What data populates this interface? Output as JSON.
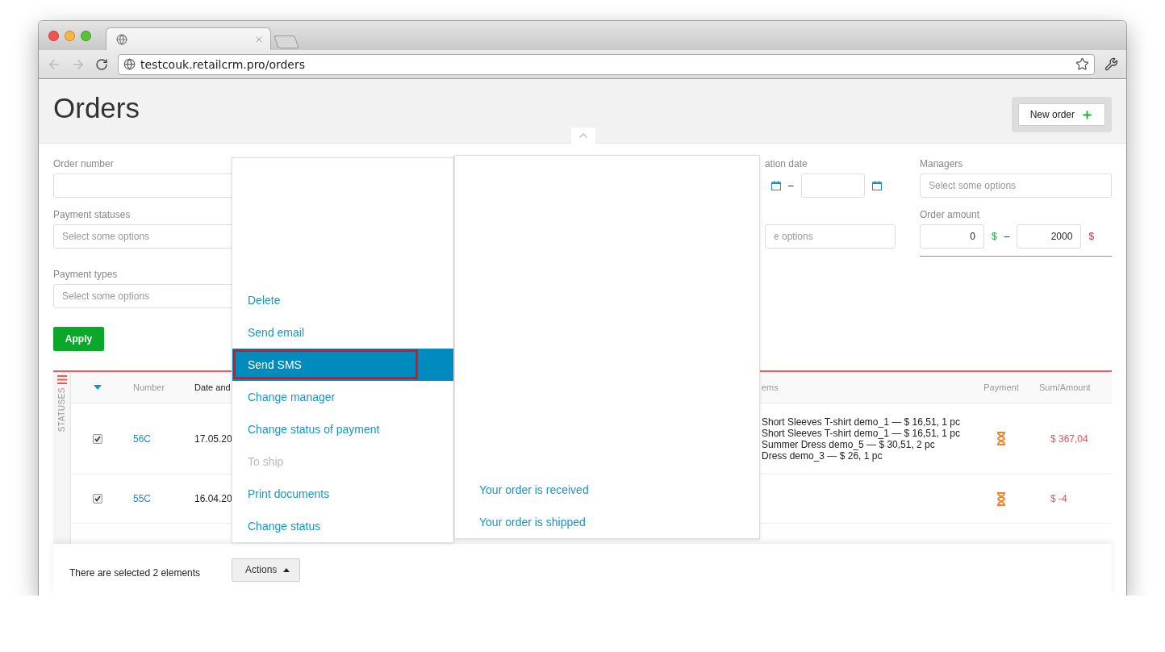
{
  "browser": {
    "url": "testcouk.retailcrm.pro/orders"
  },
  "page": {
    "title": "Orders",
    "new_order_button": "New order"
  },
  "filters": {
    "order_number": {
      "label": "Order number"
    },
    "payment_statuses": {
      "label": "Payment statuses",
      "placeholder": "Select some options"
    },
    "payment_types": {
      "label": "Payment types",
      "placeholder": "Select some options"
    },
    "date": {
      "label": "ation date",
      "separator": "–"
    },
    "column_3_field": {
      "placeholder": "e options"
    },
    "managers": {
      "label": "Managers",
      "placeholder": "Select some options"
    },
    "order_amount": {
      "label": "Order amount",
      "from": "0",
      "to": "2000",
      "currency": "$",
      "separator": "–"
    },
    "apply_button": "Apply"
  },
  "table": {
    "sidebar_label": "STATUSES",
    "columns": [
      {
        "label": "Number",
        "sorted": false
      },
      {
        "label": "Date and",
        "sorted": true
      },
      {
        "label": "ems",
        "sorted": false
      },
      {
        "label": "Payment",
        "sorted": false
      },
      {
        "label": "Sum/Amount",
        "sorted": false
      }
    ],
    "rows": [
      {
        "checked": true,
        "number": "56C",
        "date": "17.05.20",
        "items": [
          "Short Sleeves T-shirt demo_1 — $ 16,51, 1 pc",
          "Short Sleeves T-shirt demo_1 — $ 16,51, 1 pc",
          "Summer Dress demo_5 — $ 30,51, 2 pc",
          "Dress demo_3 — $ 26, 1 pc"
        ],
        "sum": "$ 367,04"
      },
      {
        "checked": true,
        "number": "55C",
        "date": "16.04.20",
        "items": [],
        "sum": "$ -4"
      }
    ]
  },
  "selection": {
    "text": "There are selected 2 elements",
    "actions_button": "Actions"
  },
  "actions_menu": {
    "items": [
      {
        "label": "Delete",
        "selected": false,
        "disabled": false,
        "annotated": false
      },
      {
        "label": "Send email",
        "selected": false,
        "disabled": false,
        "annotated": false
      },
      {
        "label": "Send SMS",
        "selected": true,
        "disabled": false,
        "annotated": true
      },
      {
        "label": "Change manager",
        "selected": false,
        "disabled": false,
        "annotated": false
      },
      {
        "label": "Change status of payment",
        "selected": false,
        "disabled": false,
        "annotated": false
      },
      {
        "label": "To ship",
        "selected": false,
        "disabled": true,
        "annotated": false
      },
      {
        "label": "Print documents",
        "selected": false,
        "disabled": false,
        "annotated": false
      },
      {
        "label": "Change status",
        "selected": false,
        "disabled": false,
        "annotated": false
      }
    ]
  },
  "submenu": {
    "items": [
      {
        "label": "Your order is received"
      },
      {
        "label": "Your order is shipped"
      }
    ]
  }
}
